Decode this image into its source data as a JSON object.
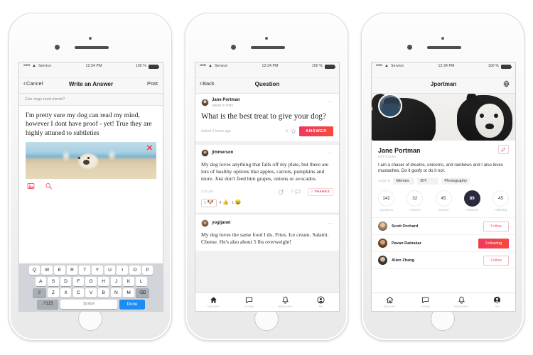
{
  "statusbar": {
    "signal_dots": "•••••",
    "wifi_icon": "wifi-icon",
    "carrier": "Service",
    "time": "12:34 PM",
    "battery_text": "100 %"
  },
  "phone1": {
    "nav": {
      "back_label": "Cancel",
      "title": "Write an Answer",
      "post_label": "Post"
    },
    "context_question": "Can dogs read minds?",
    "answer_text": "I'm pretty sure my dog can read my mind, however I dont have proof - yet!  True they are highly attuned to subtleties",
    "attachment": {
      "alt": "dog-on-beach-photo",
      "remove_label": "✕"
    },
    "tools": [
      "photo-icon",
      "search-icon"
    ],
    "keyboard": {
      "row1": [
        "Q",
        "W",
        "E",
        "R",
        "T",
        "Y",
        "U",
        "I",
        "O",
        "P"
      ],
      "row2": [
        "A",
        "S",
        "D",
        "F",
        "G",
        "H",
        "J",
        "K",
        "L"
      ],
      "row3_shift": "⇧",
      "row3": [
        "Z",
        "X",
        "C",
        "V",
        "B",
        "N",
        "M"
      ],
      "row3_back": "⌫",
      "numbers_key": ".?123",
      "space_key": "space",
      "done_key": "Done"
    }
  },
  "phone2": {
    "nav": {
      "back_label": "Back",
      "title": "Question"
    },
    "question": {
      "author": "Jane Portman",
      "author_sub": "asked in Pets",
      "title": "What is the best treat to give your dog?",
      "asked_time": "Asked 4 hours ago",
      "star_count": "5",
      "answer_button": "ANSWER"
    },
    "answers": [
      {
        "author": "jimmerson",
        "text": "My dog loves anything that falls off my plate, but there are lots of healthy options like apples, carrots, pumpkins and more. Just don't feed him grapes, onions or avocados.",
        "time": "2:31 pm",
        "comment_count": "0",
        "thanks_count": "2",
        "thanks_label": "THANKS",
        "reactions": [
          {
            "emoji": "🐶",
            "count": "1"
          },
          {
            "emoji": "👍",
            "count": "4"
          },
          {
            "emoji": "😄",
            "count": "1"
          }
        ]
      },
      {
        "author": "yogijanet",
        "text": "My dog loves the same food I do. Fries. Ice cream. Salami. Cheese. He's also about 5 lbs overweight!"
      }
    ]
  },
  "phone3": {
    "nav": {
      "title": "Jportman",
      "settings_icon": "gear-icon"
    },
    "cover_alt": "two-dogs-cover-photo",
    "profile": {
      "name": "Jane Portman",
      "thanks": "609 Thanks",
      "edit_icon": "pencil-icon",
      "bio": "I am a chaser of dreams, unicorns, and rainbows and I also loves mustaches. Do it goofy or do it not.",
      "active_label": "Active in",
      "tags": [
        "Memes",
        "DIY",
        "Photography"
      ]
    },
    "stats": [
      {
        "value": "142",
        "label": "Questions",
        "active": false
      },
      {
        "value": "32",
        "label": "Answers",
        "active": false
      },
      {
        "value": "45",
        "label": "Starred",
        "active": false
      },
      {
        "value": "89",
        "label": "Followers",
        "active": true
      },
      {
        "value": "45",
        "label": "Following",
        "active": false
      }
    ],
    "followers": [
      {
        "name": "Scott Orchard",
        "action": "Follow",
        "following": false
      },
      {
        "name": "Pavan Ratnakar",
        "action": "Following",
        "following": true
      },
      {
        "name": "Allen Zhang",
        "action": "Follow",
        "following": false
      }
    ]
  },
  "tabbar": {
    "items": [
      {
        "label": "Discover",
        "icon": "home-icon"
      },
      {
        "label": "Answer",
        "icon": "chat-icon"
      },
      {
        "label": "Notification",
        "icon": "bell-icon"
      },
      {
        "label": "Me",
        "icon": "person-icon"
      }
    ]
  },
  "colors": {
    "accent": "#f0375f",
    "accent2": "#f74a3a",
    "blue": "#1b8df3",
    "dark": "#2b2b3d"
  }
}
